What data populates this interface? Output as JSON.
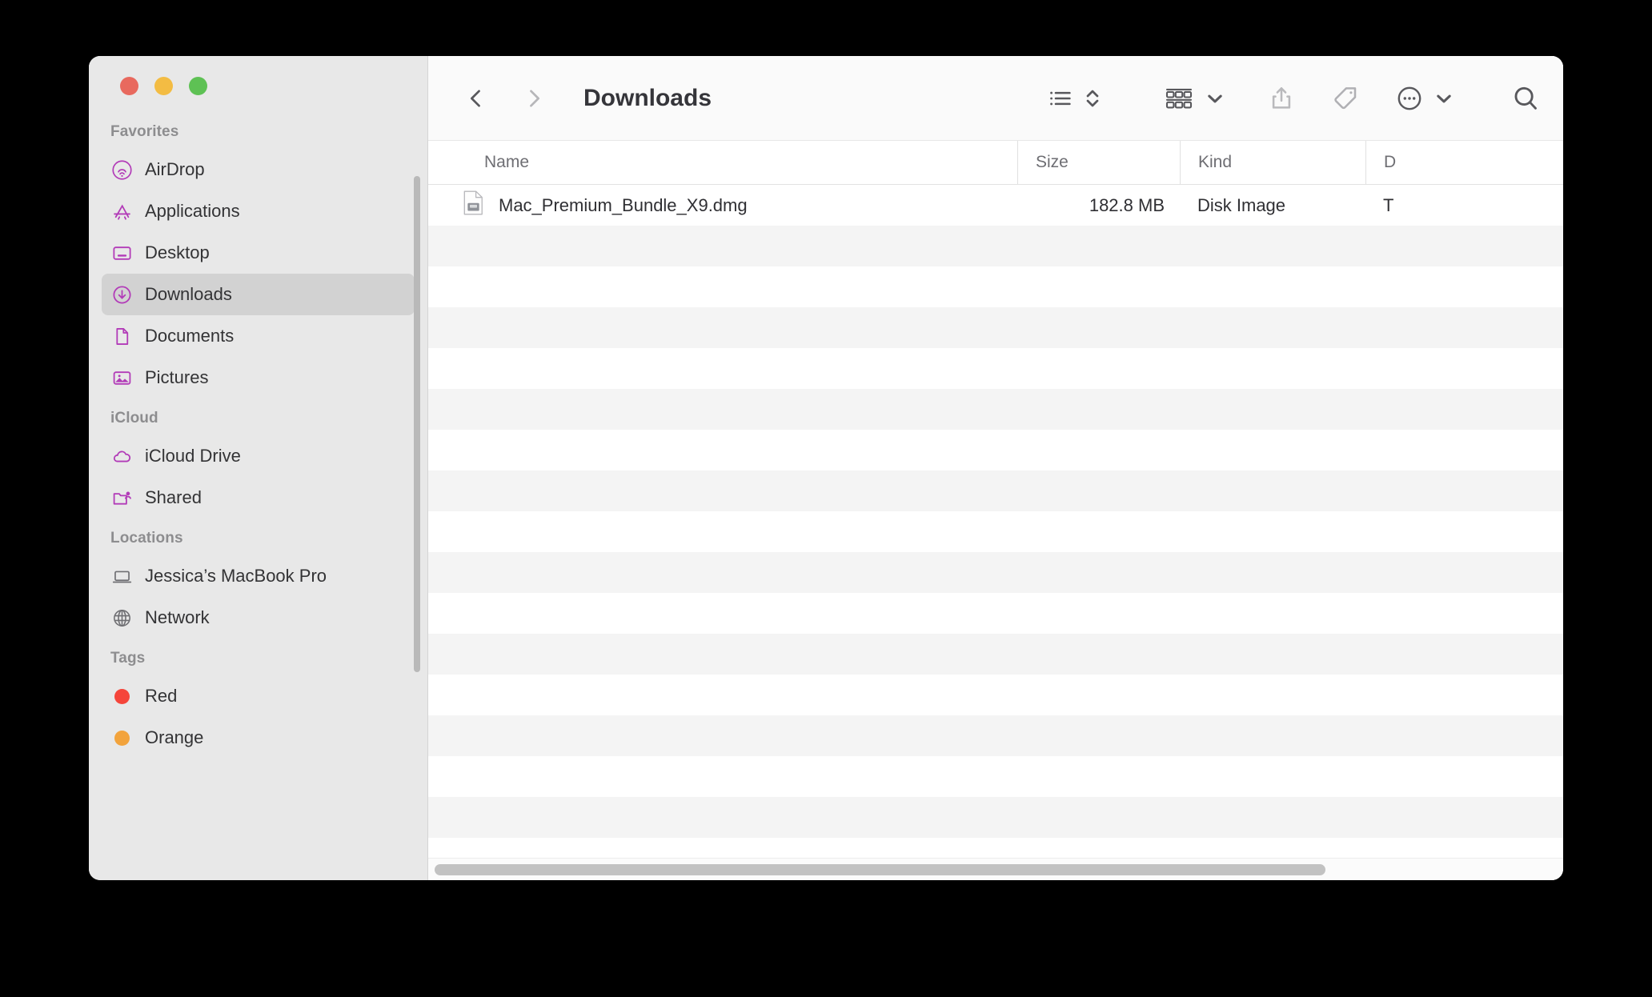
{
  "window": {
    "title": "Downloads",
    "traffic_lights": [
      {
        "name": "close",
        "color": "#e8695e"
      },
      {
        "name": "minimize",
        "color": "#f3bc43"
      },
      {
        "name": "maximize",
        "color": "#5ec154"
      }
    ]
  },
  "toolbar": {
    "back_label": "Back",
    "forward_label": "Forward",
    "items": [
      {
        "name": "list-view-icon",
        "label": "List View"
      },
      {
        "name": "sort-chevrons-icon",
        "label": "Sort Order"
      },
      {
        "name": "group-view-icon",
        "label": "Group By"
      },
      {
        "name": "group-chevron-down-icon",
        "label": "Group Options"
      },
      {
        "name": "share-icon",
        "label": "Share"
      },
      {
        "name": "tag-icon",
        "label": "Tags"
      },
      {
        "name": "more-actions-icon",
        "label": "More Actions"
      },
      {
        "name": "more-chevron-down-icon",
        "label": "More Options"
      },
      {
        "name": "search-icon",
        "label": "Search"
      }
    ]
  },
  "sidebar": {
    "sections": [
      {
        "header": "Favorites",
        "items": [
          {
            "label": "AirDrop",
            "icon": "airdrop-icon",
            "selected": false
          },
          {
            "label": "Applications",
            "icon": "applications-icon",
            "selected": false
          },
          {
            "label": "Desktop",
            "icon": "desktop-icon",
            "selected": false
          },
          {
            "label": "Downloads",
            "icon": "downloads-icon",
            "selected": true
          },
          {
            "label": "Documents",
            "icon": "documents-icon",
            "selected": false
          },
          {
            "label": "Pictures",
            "icon": "pictures-icon",
            "selected": false
          }
        ]
      },
      {
        "header": "iCloud",
        "items": [
          {
            "label": "iCloud Drive",
            "icon": "icloud-drive-icon",
            "selected": false
          },
          {
            "label": "Shared",
            "icon": "shared-folder-icon",
            "selected": false
          }
        ]
      },
      {
        "header": "Locations",
        "items": [
          {
            "label": "Jessica’s MacBook Pro",
            "icon": "laptop-icon",
            "selected": false
          },
          {
            "label": "Network",
            "icon": "network-globe-icon",
            "selected": false
          }
        ]
      },
      {
        "header": "Tags",
        "items": [
          {
            "label": "Red",
            "icon": "tag-dot-red",
            "color": "#f5453a",
            "selected": false
          },
          {
            "label": "Orange",
            "icon": "tag-dot-orange",
            "color": "#f2a33c",
            "selected": false
          }
        ]
      }
    ],
    "accent_color": "#b23bb8",
    "selected_bg": "#d2d2d2"
  },
  "file_list": {
    "columns": [
      "Name",
      "Size",
      "Kind",
      "D"
    ],
    "rows": [
      {
        "name": "Mac_Premium_Bundle_X9.dmg",
        "size": "182.8 MB",
        "kind": "Disk Image",
        "date": "T",
        "icon": "disk-image-file-icon"
      }
    ],
    "empty_row_count": 18
  }
}
